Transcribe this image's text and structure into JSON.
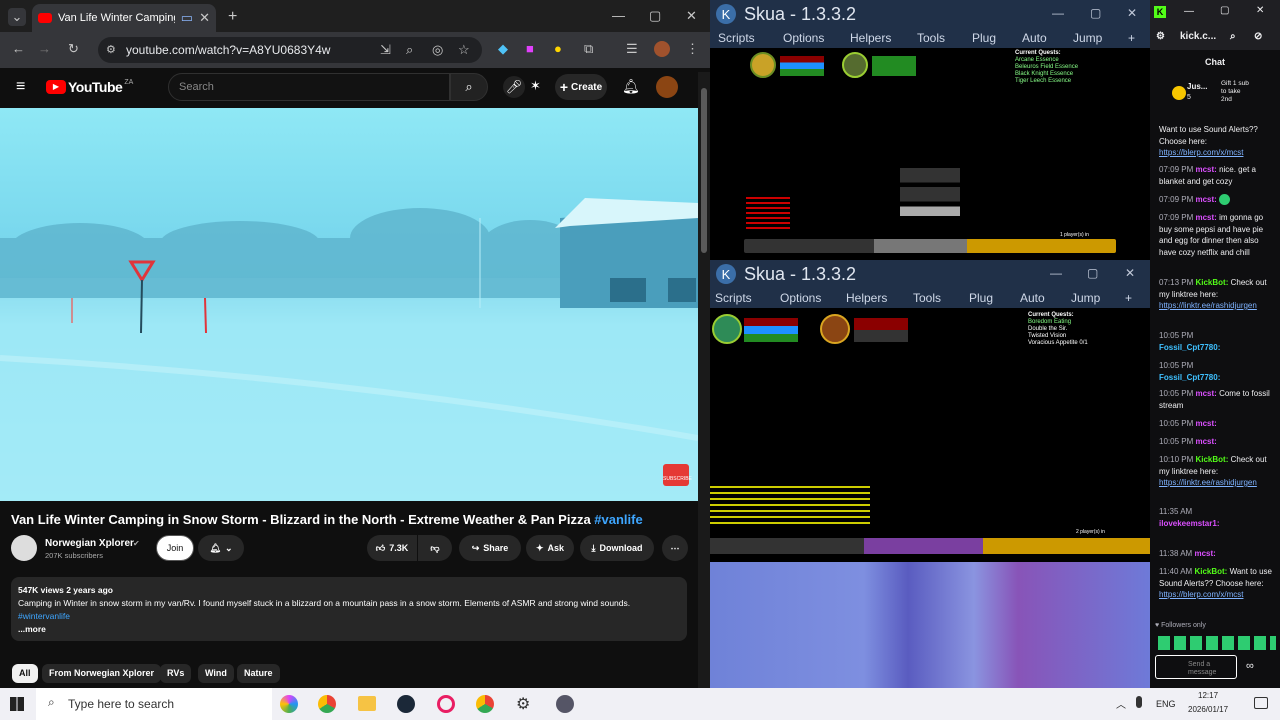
{
  "browser": {
    "tab_title": "Van Life Winter Camping in",
    "url": "youtube.com/watch?v=A8YU0683Y4w"
  },
  "youtube": {
    "logo": "YouTube",
    "logo_suffix": "ZA",
    "search_placeholder": "Search",
    "create_label": "Create",
    "video_title": "Van Life Winter Camping in Snow Storm - Blizzard in the North - Extreme Weather & Pan Pizza",
    "video_hashtag": "#vanlife",
    "channel": "Norwegian Xplorer",
    "subscribers": "207K subscribers",
    "join_label": "Join",
    "likes": "7.3K",
    "share_label": "Share",
    "ask_label": "Ask",
    "download_label": "Download",
    "views_date": "547K views  2 years ago",
    "description": "Camping in Winter in snow storm in my van/Rv. I found myself stuck in a blizzard on a mountain pass in a snow storm. Elements of ASMR and strong wind sounds.",
    "description_tag": "#wintervanlife",
    "more_label": "...more",
    "subscribe_overlay": "SUBSCRIBE",
    "chips": [
      "All",
      "From Norwegian Xplorer",
      "RVs",
      "Wind",
      "Nature"
    ]
  },
  "skua_top": {
    "title": "Skua - 1.3.3.2",
    "menu": [
      "Scripts",
      "Options",
      "Helpers",
      "Tools",
      "Plug",
      "Auto",
      "Jump"
    ],
    "quests_header": "Current Quests:",
    "quests": [
      "Arcane Essence",
      "Beleuros Field Essence",
      "Black Knight Essence",
      "Tiger Leech Essence"
    ],
    "players": "1 player(s) in"
  },
  "skua_bottom": {
    "title": "Skua - 1.3.3.2",
    "menu": [
      "Scripts",
      "Options",
      "Helpers",
      "Tools",
      "Plug",
      "Auto",
      "Jump"
    ],
    "quests_header": "Current Quests:",
    "quests": [
      "Boredom Eating",
      "Double the Sir.",
      "Twisted Vision",
      "Voracious Appetite 0/1"
    ],
    "players": "2 player(s) in"
  },
  "chat": {
    "channel_short": "kick.c...",
    "header": "Chat",
    "gift_user": "Jus...",
    "gift_count": "5",
    "gift_text": "Gift 1 sub to take 2nd",
    "messages": [
      {
        "time": "",
        "user": "",
        "text": "Want to use Sound Alerts?? Choose here:",
        "link": "https://blerp.com/x/mcst"
      },
      {
        "time": "07:09 PM",
        "user": "mcst:",
        "text": "nice. get a blanket and get cozy",
        "link": ""
      },
      {
        "time": "07:09 PM",
        "user": "mcst:",
        "text": "",
        "link": ""
      },
      {
        "time": "07:09 PM",
        "user": "mcst:",
        "text": "im gonna go buy some pepsi and have pie and egg for dinner then also have cozy netflix and chill",
        "link": ""
      },
      {
        "time": "07:13 PM",
        "user": "KickBot:",
        "text": "Check out my linktree here:",
        "link": "https://linktr.ee/rashidjurgen"
      },
      {
        "time": "10:05 PM",
        "user": "Fossil_Cpt7780:",
        "text": "",
        "link": ""
      },
      {
        "time": "10:05 PM",
        "user": "Fossil_Cpt7780:",
        "text": "",
        "link": ""
      },
      {
        "time": "10:05 PM",
        "user": "mcst:",
        "text": "Come to fossil stream",
        "link": ""
      },
      {
        "time": "10:05 PM",
        "user": "mcst:",
        "text": "",
        "link": ""
      },
      {
        "time": "10:05 PM",
        "user": "mcst:",
        "text": "",
        "link": ""
      },
      {
        "time": "10:10 PM",
        "user": "KickBot:",
        "text": "Check out my linktree here:",
        "link": "https://linktr.ee/rashidjurgen"
      },
      {
        "time": "11:35 AM",
        "user": "ilovekeemstar1:",
        "text": "",
        "link": ""
      },
      {
        "time": "11:38 AM",
        "user": "mcst:",
        "text": "",
        "link": ""
      },
      {
        "time": "11:40 AM",
        "user": "KickBot:",
        "text": "Want to use Sound Alerts?? Choose here:",
        "link": "https://blerp.com/x/mcst"
      }
    ],
    "followers_only": "Followers only",
    "send_placeholder": "Send a message"
  },
  "taskbar": {
    "search_placeholder": "Type here to search",
    "lang": "ENG",
    "time": "12:17",
    "date": "2026/01/17"
  }
}
